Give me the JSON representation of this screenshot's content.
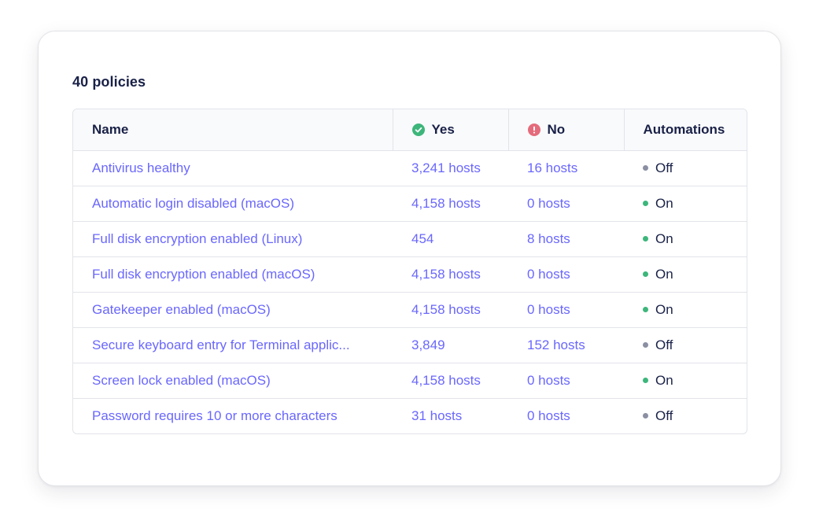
{
  "header": {
    "count_label": "40 policies"
  },
  "table": {
    "columns": {
      "name": "Name",
      "yes": "Yes",
      "no": "No",
      "automations": "Automations"
    },
    "rows": [
      {
        "name": "Antivirus healthy",
        "yes": "3,241 hosts",
        "no": "16 hosts",
        "automation": "Off",
        "automation_state": "off"
      },
      {
        "name": "Automatic login disabled (macOS)",
        "yes": "4,158 hosts",
        "no": "0 hosts",
        "automation": "On",
        "automation_state": "on"
      },
      {
        "name": "Full disk encryption enabled (Linux)",
        "yes": "454",
        "no": "8 hosts",
        "automation": "On",
        "automation_state": "on"
      },
      {
        "name": "Full disk encryption enabled (macOS)",
        "yes": "4,158 hosts",
        "no": "0 hosts",
        "automation": "On",
        "automation_state": "on"
      },
      {
        "name": "Gatekeeper enabled (macOS)",
        "yes": "4,158 hosts",
        "no": "0 hosts",
        "automation": "On",
        "automation_state": "on"
      },
      {
        "name": "Secure keyboard entry for Terminal applic...",
        "yes": "3,849",
        "no": "152 hosts",
        "automation": "Off",
        "automation_state": "off"
      },
      {
        "name": "Screen lock enabled (macOS)",
        "yes": "4,158 hosts",
        "no": "0 hosts",
        "automation": "On",
        "automation_state": "on"
      },
      {
        "name": "Password requires 10 or more characters",
        "yes": "31 hosts",
        "no": "0 hosts",
        "automation": "Off",
        "automation_state": "off"
      }
    ]
  },
  "icons": {
    "yes": "check-circle-icon",
    "no": "exclamation-circle-icon",
    "automation_status": "status-dot-icon"
  },
  "colors": {
    "link": "#6a67fe",
    "heading": "#192147",
    "success": "#3db67b",
    "error": "#e46b7b",
    "inactive": "#8b8fa2"
  }
}
